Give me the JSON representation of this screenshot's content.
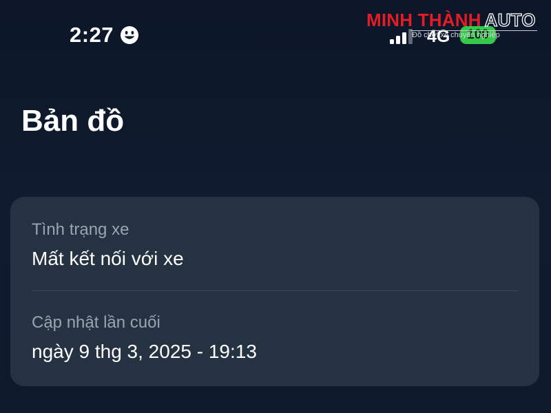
{
  "status_bar": {
    "time": "2:27",
    "status_icon": "smiley-icon",
    "signal_icon": "signal-bars-icon",
    "network": "4G",
    "battery": "100",
    "battery_color": "#35c84a"
  },
  "watermark": {
    "brand_red": "MINH THÀNH",
    "brand_white": "AUTO",
    "slogan": "Đồ chơi xe chuyên nghiệp",
    "brand_color": "#e21d25"
  },
  "page": {
    "title": "Bản đồ"
  },
  "card": {
    "status_label": "Tình trạng xe",
    "status_value": "Mất kết nối với xe",
    "update_label": "Cập nhật lần cuối",
    "update_value": "ngày 9 thg 3, 2025 - 19:13"
  },
  "colors": {
    "background": "#0f1b2e",
    "card": "#253241",
    "label": "#9aa5b3"
  }
}
